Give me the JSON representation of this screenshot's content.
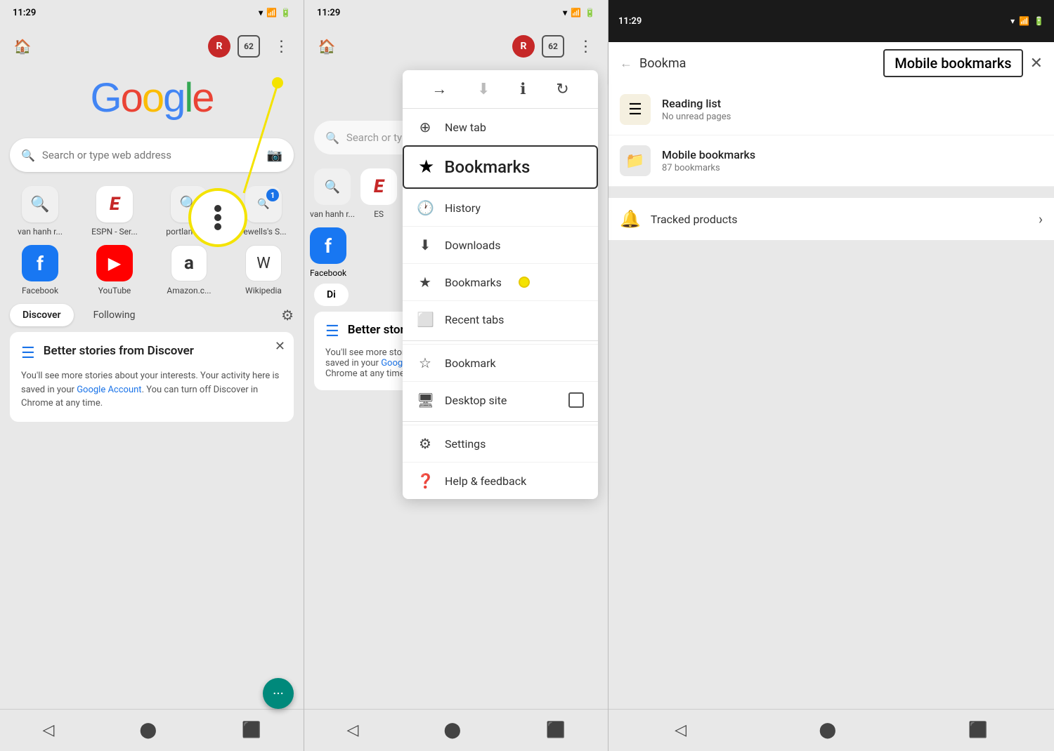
{
  "panels": {
    "left": {
      "status_time": "11:29",
      "toolbar": {
        "avatar_letter": "R",
        "tabs_count": "62",
        "menu_dots": "⋮"
      },
      "search_placeholder": "Search or type web address",
      "quick_access": [
        {
          "label": "van hanh r...",
          "icon": "🔍",
          "bg": "#f0f0f0"
        },
        {
          "label": "ESPN - Ser...",
          "icon": "E",
          "bg": "#fff",
          "color": "#c62828"
        },
        {
          "label": "portland w...",
          "icon": "🔍",
          "bg": "#f0f0f0"
        },
        {
          "label": "rewells's S...",
          "icon": "1",
          "bg": "#f0f0f0"
        }
      ],
      "shortcuts": [
        {
          "label": "Facebook",
          "bg": "#1877f2",
          "icon": "f"
        },
        {
          "label": "YouTube",
          "bg": "#ff0000",
          "icon": "▶"
        },
        {
          "label": "Amazon.c...",
          "bg": "#ff9900",
          "icon": "a"
        },
        {
          "label": "Wikipedia",
          "bg": "#fff",
          "icon": "W"
        }
      ],
      "discover_tabs": [
        "Discover",
        "Following"
      ],
      "discover_active": "Discover",
      "card": {
        "title": "Better stories from Discover",
        "body": "You'll see more stories about your interests. Your activity here is saved in your ",
        "link_text": "Google Account",
        "body_end": ". You can turn off Discover in Chrome at any time."
      },
      "annotation_label": "three-dot menu"
    },
    "middle": {
      "status_time": "11:29",
      "menu": {
        "bookmarks_label": "Bookmarks",
        "items": [
          {
            "icon": "🕐",
            "label": "History"
          },
          {
            "icon": "⬇",
            "label": "Downloads"
          },
          {
            "icon": "★",
            "label": "Bookmarks"
          },
          {
            "icon": "⬜",
            "label": "Recent tabs"
          },
          {
            "icon": "☆",
            "label": "Bookmark"
          },
          {
            "icon": "🖥",
            "label": "Desktop site"
          },
          {
            "icon": "⚙",
            "label": "Settings"
          },
          {
            "icon": "❓",
            "label": "Help & feedback"
          }
        ]
      }
    },
    "right": {
      "status_time": "11:29",
      "header": {
        "back_text": "Bookma",
        "title": "Mobile bookmarks",
        "close": "✕"
      },
      "reading_list": {
        "title": "Reading list",
        "subtitle": "No unread pages"
      },
      "mobile_bookmarks": {
        "title": "Mobile bookmarks",
        "subtitle": "87 bookmarks"
      },
      "tracked": {
        "label": "Tracked products",
        "arrow": "›"
      },
      "annotation": "Mobile bookmarks"
    }
  }
}
